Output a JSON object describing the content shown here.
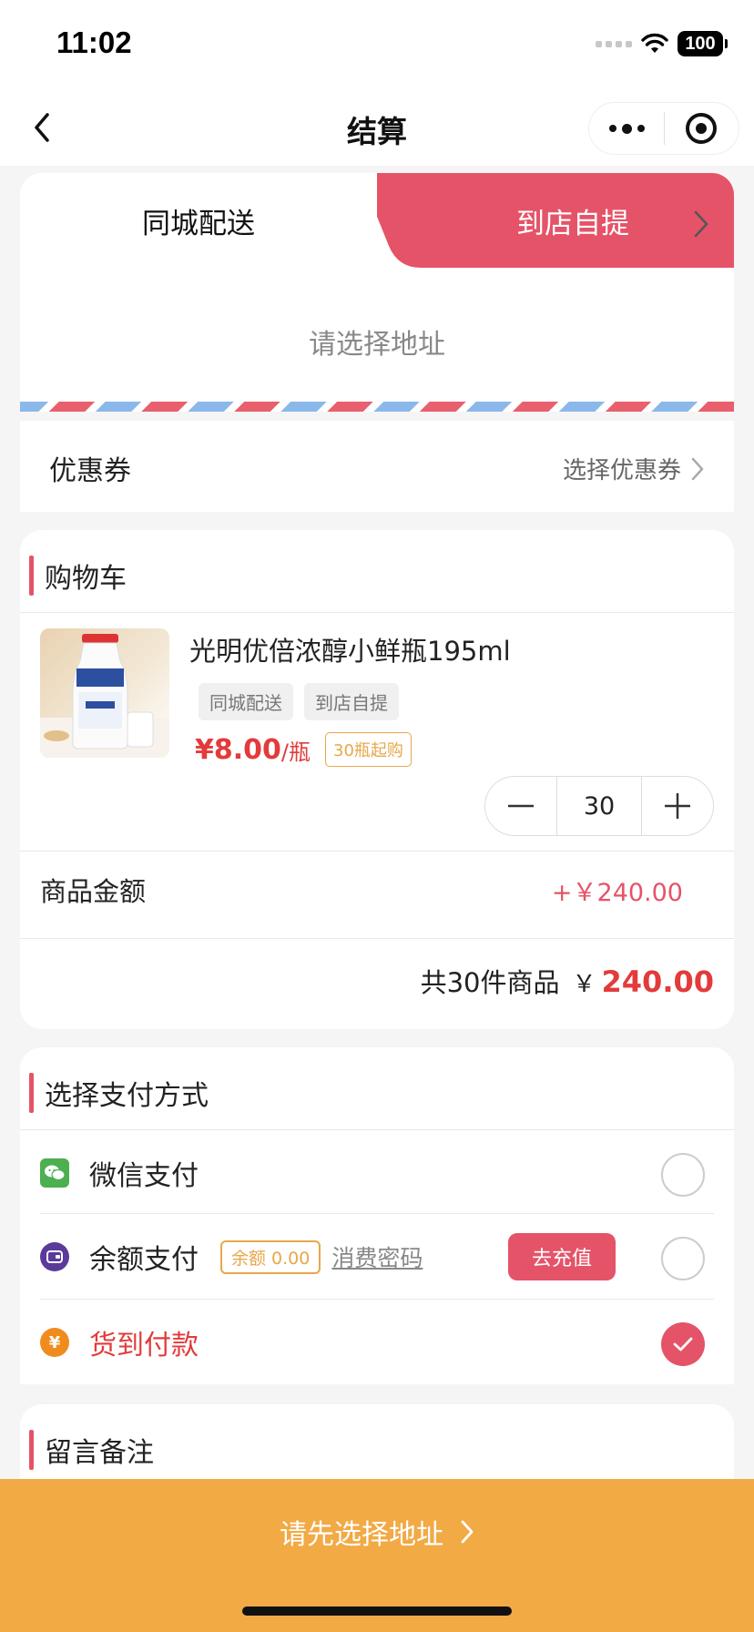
{
  "status": {
    "time": "11:02",
    "battery": "100"
  },
  "nav": {
    "title": "结算"
  },
  "delivery_tabs": [
    {
      "label": "同城配送",
      "selected": false
    },
    {
      "label": "到店自提",
      "selected": true
    }
  ],
  "address": {
    "placeholder": "请选择地址"
  },
  "coupon": {
    "label": "优惠券",
    "value": "选择优惠券"
  },
  "cart": {
    "title": "购物车",
    "product": {
      "name": "光明优倍浓醇小鲜瓶195ml",
      "tags": [
        "同城配送",
        "到店自提"
      ],
      "price": "¥8.00",
      "unit": "/瓶",
      "min_purchase": "30瓶起购",
      "quantity": "30"
    },
    "amount_label": "商品金额",
    "amount_value": "+￥240.00",
    "total_count": "共30件商品",
    "total_currency": "￥",
    "total_value": "240.00"
  },
  "payment": {
    "title": "选择支付方式",
    "options": [
      {
        "label": "微信支付",
        "icon": "wechat-pay-icon",
        "selected": false
      },
      {
        "label": "余额支付",
        "icon": "wallet-icon",
        "selected": false,
        "balance": "余额 0.00",
        "password_link": "消费密码",
        "recharge": "去充值"
      },
      {
        "label": "货到付款",
        "icon": "yen-icon",
        "selected": true
      }
    ]
  },
  "remark": {
    "title": "留言备注"
  },
  "submit": {
    "label": "请先选择地址"
  },
  "colors": {
    "accent": "#e55368",
    "price": "#e33b3b",
    "submit_bg": "#f2aa45",
    "tag_orange": "#e8a74a"
  }
}
